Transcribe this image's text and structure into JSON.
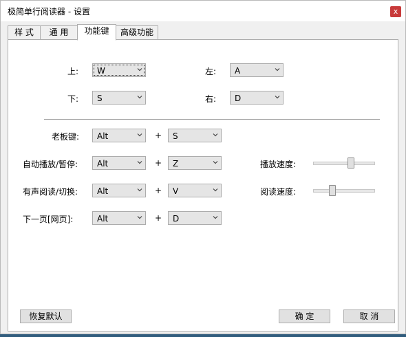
{
  "window": {
    "title": "极简单行阅读器 - 设置",
    "close_glyph": "x"
  },
  "tabs": [
    {
      "label": "样 式"
    },
    {
      "label": "通 用"
    },
    {
      "label": "功能键"
    },
    {
      "label": "高级功能"
    }
  ],
  "direction_keys": {
    "up": {
      "label": "上:",
      "value": "W"
    },
    "down": {
      "label": "下:",
      "value": "S"
    },
    "left": {
      "label": "左:",
      "value": "A"
    },
    "right": {
      "label": "右:",
      "value": "D"
    }
  },
  "shortcuts": [
    {
      "label": "老板键:",
      "modifier": "Alt",
      "plus": "+",
      "key": "S"
    },
    {
      "label": "自动播放/暂停:",
      "modifier": "Alt",
      "plus": "+",
      "key": "Z"
    },
    {
      "label": "有声阅读/切换:",
      "modifier": "Alt",
      "plus": "+",
      "key": "V"
    },
    {
      "label": "下一页[网页]:",
      "modifier": "Alt",
      "plus": "+",
      "key": "D"
    }
  ],
  "speeds": {
    "play": {
      "label": "播放速度:",
      "level": 0.62
    },
    "read": {
      "label": "阅读速度:",
      "level": 0.29
    }
  },
  "buttons": {
    "restore_default": "恢复默认",
    "ok": "确 定",
    "cancel": "取 消"
  }
}
